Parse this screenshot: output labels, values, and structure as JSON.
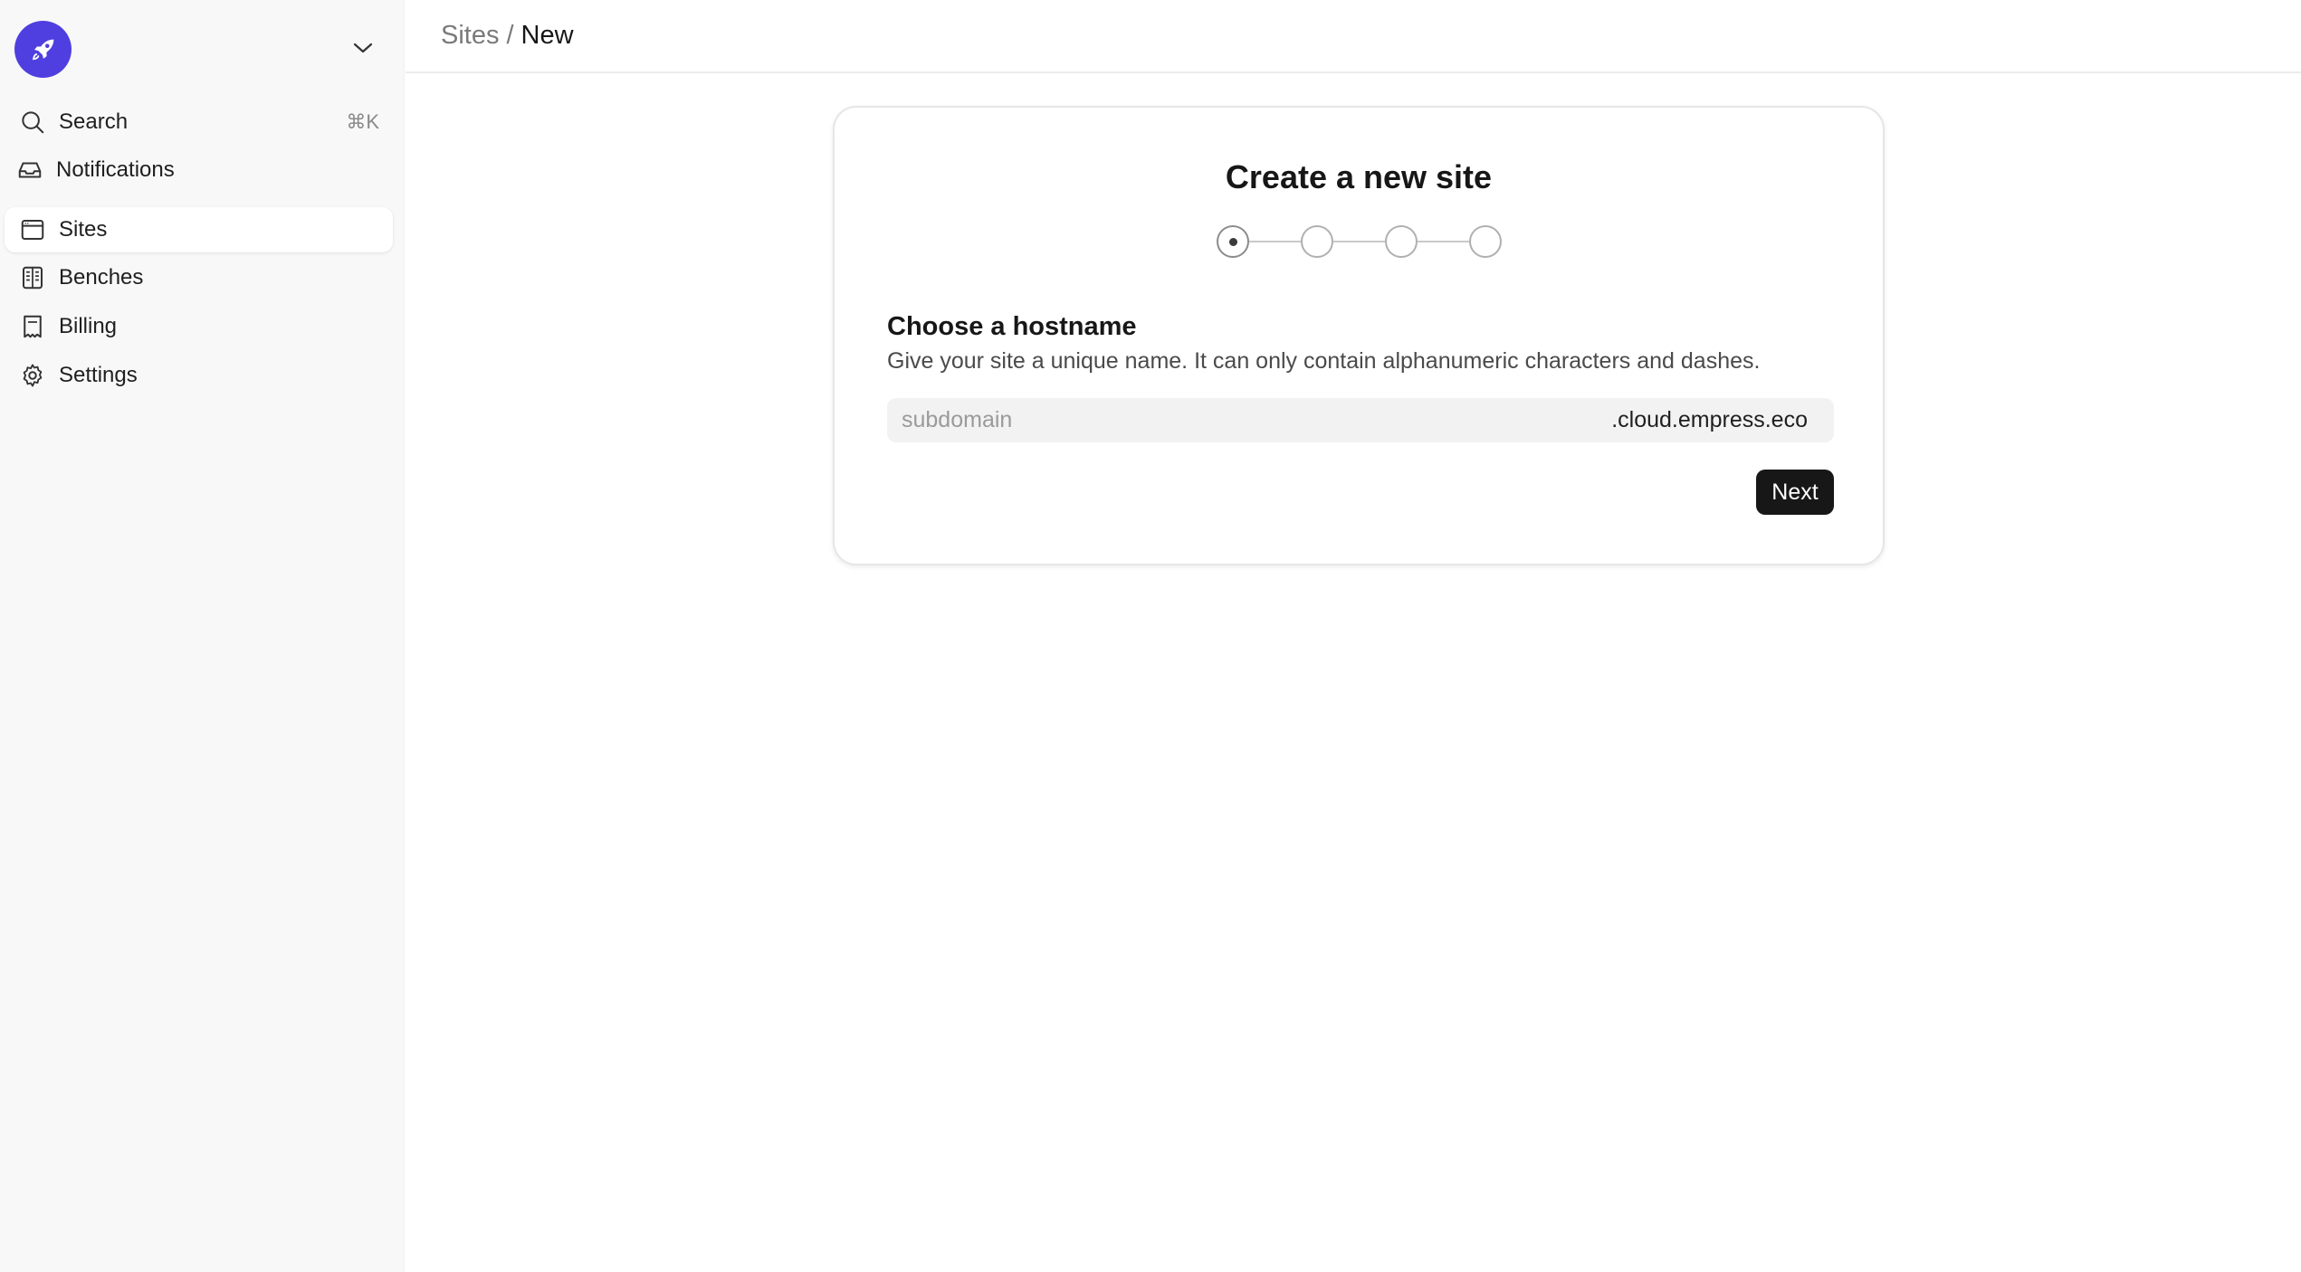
{
  "sidebar": {
    "search": {
      "label": "Search",
      "shortcut": "⌘K"
    },
    "items": [
      {
        "label": "Notifications",
        "icon": "inbox-icon"
      },
      {
        "label": "Sites",
        "icon": "browser-window-icon",
        "active": true
      },
      {
        "label": "Benches",
        "icon": "bench-columns-icon"
      },
      {
        "label": "Billing",
        "icon": "receipt-icon"
      },
      {
        "label": "Settings",
        "icon": "gear-icon"
      }
    ],
    "brand_color": "#4f3fe0"
  },
  "breadcrumb": {
    "parent": "Sites",
    "separator": "/",
    "current": "New"
  },
  "wizard": {
    "title": "Create a new site",
    "steps_total": 4,
    "current_step": 1,
    "section_title": "Choose a hostname",
    "section_description": "Give your site a unique name. It can only contain alphanumeric characters and dashes.",
    "hostname_input": {
      "placeholder": "subdomain",
      "value": "",
      "suffix": ".cloud.empress.eco"
    },
    "next_label": "Next"
  }
}
